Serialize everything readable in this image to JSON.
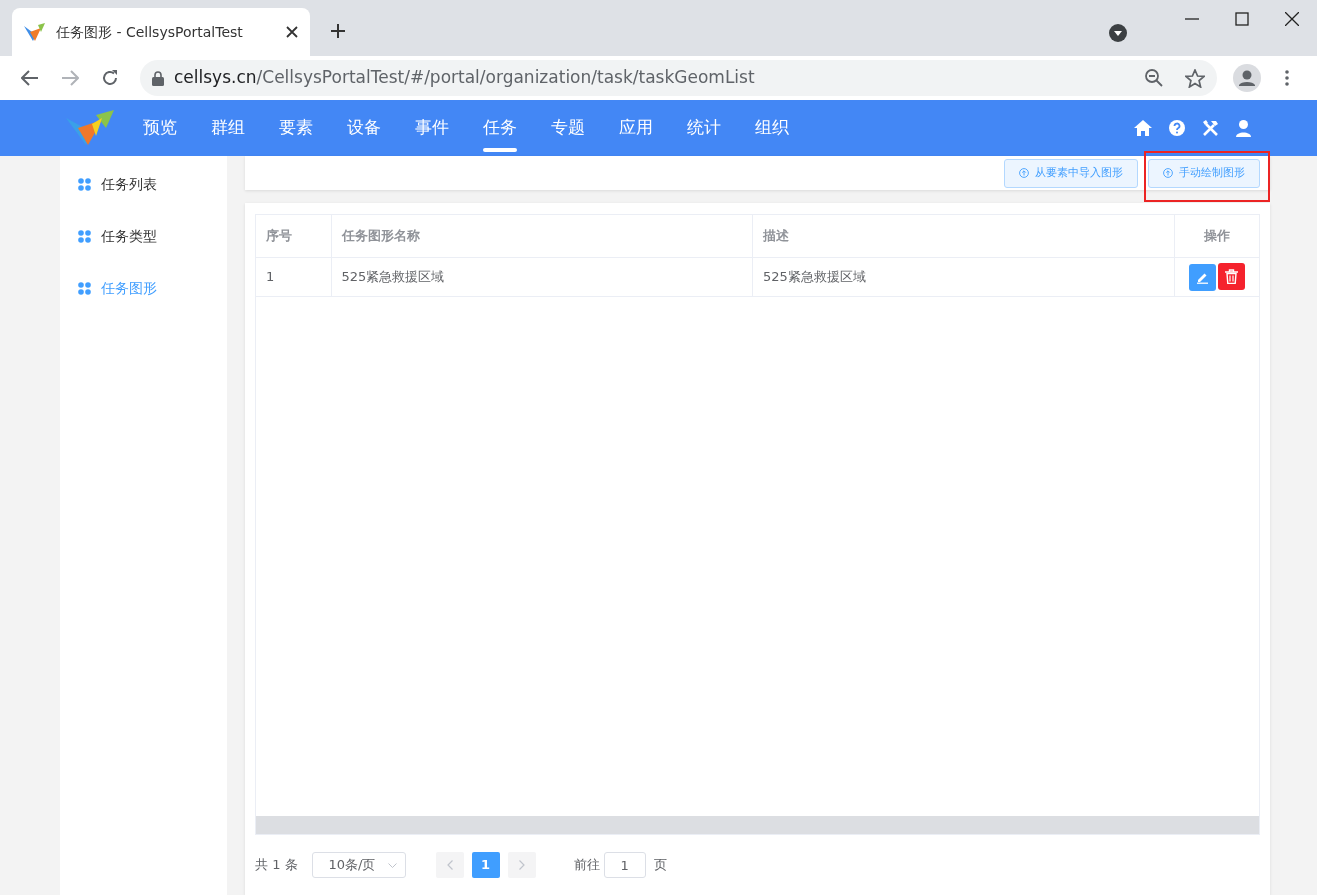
{
  "browser": {
    "tab_title": "任务图形 - CellsysPortalTest",
    "url_host": "cellsys.cn",
    "url_path": "/CellsysPortalTest/#/portal/organization/task/taskGeomList"
  },
  "nav": {
    "items": [
      {
        "label": "预览",
        "selected": false
      },
      {
        "label": "群组",
        "selected": false
      },
      {
        "label": "要素",
        "selected": false
      },
      {
        "label": "设备",
        "selected": false
      },
      {
        "label": "事件",
        "selected": false
      },
      {
        "label": "任务",
        "selected": true
      },
      {
        "label": "专题",
        "selected": false
      },
      {
        "label": "应用",
        "selected": false
      },
      {
        "label": "统计",
        "selected": false
      },
      {
        "label": "组织",
        "selected": false
      }
    ]
  },
  "sidebar": {
    "items": [
      {
        "label": "任务列表",
        "selected": false
      },
      {
        "label": "任务类型",
        "selected": false
      },
      {
        "label": "任务图形",
        "selected": true
      }
    ]
  },
  "toolbar": {
    "buttons": [
      {
        "label": "从要素中导入图形",
        "highlighted": false
      },
      {
        "label": "手动绘制图形",
        "highlighted": true
      }
    ]
  },
  "table": {
    "columns": [
      "序号",
      "任务图形名称",
      "描述",
      "操作"
    ],
    "rows": [
      {
        "cells": [
          "1",
          "525紧急救援区域",
          "525紧急救援区域"
        ]
      }
    ]
  },
  "pagination": {
    "total": "共 1 条",
    "page_size": "10条/页",
    "pages": [
      {
        "label": "1",
        "selected": true
      }
    ],
    "goto_label": "前往",
    "goto_value": "1",
    "goto_suffix": "页"
  }
}
